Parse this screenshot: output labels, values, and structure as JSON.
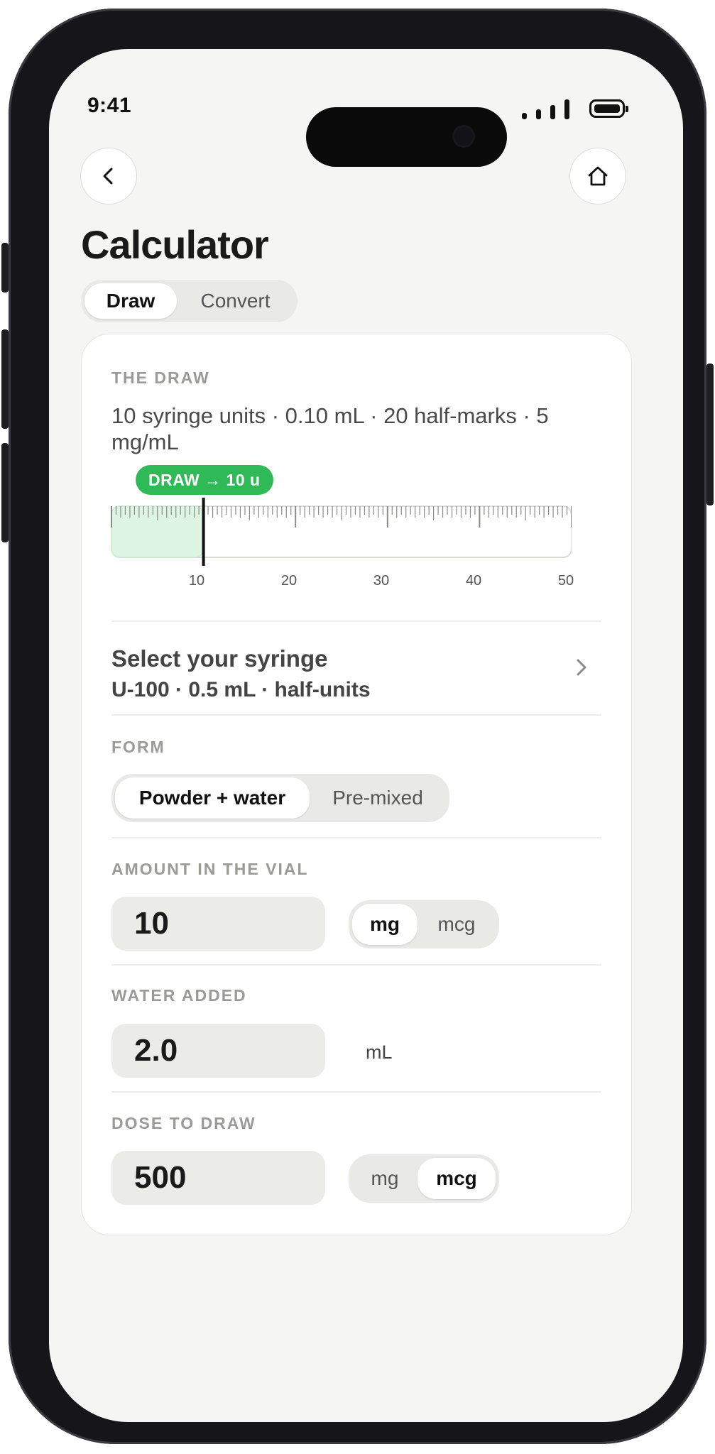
{
  "status_bar": {
    "time": "9:41"
  },
  "header": {
    "title": "Calculator"
  },
  "mode_tabs": [
    {
      "label": "Draw",
      "active": true
    },
    {
      "label": "Convert",
      "active": false
    }
  ],
  "draw_section": {
    "label": "THE DRAW",
    "summary": "10 syringe units · 0.10 mL · 20 half-marks · 5 mg/mL",
    "badge": "DRAW → 10 u",
    "draw_units": 10,
    "scale_max_units": 50,
    "tick_labels": [
      "10",
      "20",
      "30",
      "40",
      "50"
    ]
  },
  "syringe": {
    "title": "Select your syringe",
    "value": "U-100 · 0.5 mL · half-units"
  },
  "form": {
    "label": "FORM",
    "options": [
      {
        "label": "Powder + water",
        "active": true
      },
      {
        "label": "Pre-mixed",
        "active": false
      }
    ]
  },
  "vial_amount": {
    "label": "AMOUNT IN THE VIAL",
    "value": "10",
    "units": [
      {
        "label": "mg",
        "active": true
      },
      {
        "label": "mcg",
        "active": false
      }
    ]
  },
  "water_added": {
    "label": "WATER ADDED",
    "value": "2.0",
    "unit": "mL"
  },
  "dose": {
    "label": "DOSE TO DRAW",
    "value": "500",
    "units": [
      {
        "label": "mg",
        "active": false
      },
      {
        "label": "mcg",
        "active": true
      }
    ]
  },
  "colors": {
    "accent_green": "#2fba57",
    "fill_green": "#dff5e4",
    "background": "#f5f5f3"
  },
  "icons": {
    "back": "chevron-left-icon",
    "home": "home-icon",
    "row_chevron": "chevron-right-icon"
  }
}
